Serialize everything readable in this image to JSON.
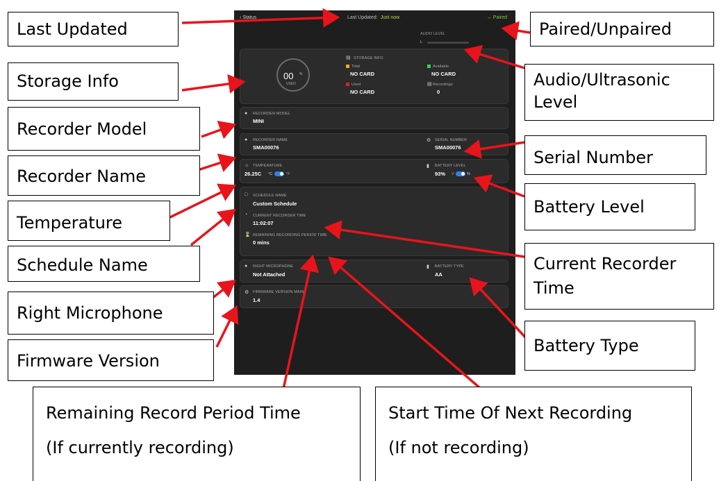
{
  "app": {
    "back_label": "Status",
    "last_updated_label": "Last Updated:",
    "last_updated_value": "Just now",
    "paired_status": "Paired",
    "audio_level_label": "AUDIO LEVEL",
    "audio_channel": "L"
  },
  "storage": {
    "percent": "00",
    "percent_sign": "%",
    "used_caption": "USED",
    "title": "STORAGE INFO",
    "total_label": "Total",
    "total_value": "NO CARD",
    "available_label": "Available",
    "available_value": "NO CARD",
    "used_label": "Used",
    "used_value": "NO CARD",
    "recordings_label": "Recordings",
    "recordings_value": "0",
    "colors": {
      "total": "#f5a623",
      "available": "#35d44a",
      "used": "#e02020"
    }
  },
  "recorder": {
    "model_label": "RECORDER MODEL",
    "model_value": "MINI",
    "name_label": "RECORDER NAME",
    "name_value": "SMA00076",
    "serial_label": "SERIAL NUMBER",
    "serial_value": "SMA00076",
    "temperature_label": "TEMPERATURE",
    "temperature_value": "26.25C",
    "temp_unit_c": "°C",
    "temp_unit_f": "°F",
    "battery_label": "BATTERY LEVEL",
    "battery_value": "93%",
    "battery_unit_v": "V",
    "battery_unit_pct": "%",
    "schedule_label": "SCHEDULE NAME",
    "schedule_value": "Custom Schedule",
    "current_time_label": "CURRENT RECORDER TIME",
    "current_time_value": "11:02:07",
    "remaining_label": "REMAINING RECORDING PERIOD TIME",
    "remaining_value": "0 mins",
    "right_mic_label": "RIGHT MICROPHONE",
    "right_mic_value": "Not Attached",
    "battery_type_label": "BATTERY TYPE",
    "battery_type_value": "AA",
    "firmware_label": "FIRMWARE VERSION MAIN",
    "firmware_value": "1.4"
  },
  "callouts": {
    "last_updated": "Last Updated",
    "storage_info": "Storage Info",
    "recorder_model": "Recorder Model",
    "recorder_name": "Recorder Name",
    "temperature": "Temperature",
    "schedule_name": "Schedule Name",
    "right_microphone": "Right Microphone",
    "firmware_version": "Firmware Version",
    "paired": "Paired/Unpaired",
    "audio_level_1": "Audio/Ultrasonic",
    "audio_level_2": "Level",
    "serial_number": "Serial Number",
    "battery_level": "Battery Level",
    "current_time_1": "Current Recorder",
    "current_time_2": "Time",
    "battery_type": "Battery Type",
    "remaining_1": "Remaining Record Period Time",
    "remaining_2": "(If currently recording)",
    "start_next_1": "Start Time Of Next Recording",
    "start_next_2": "(If not recording)"
  },
  "colors": {
    "arrow": "#e8141c",
    "app_bg": "#1e1e1e",
    "card_bg": "#2b2b2b",
    "toggle": "#2f82e8"
  }
}
